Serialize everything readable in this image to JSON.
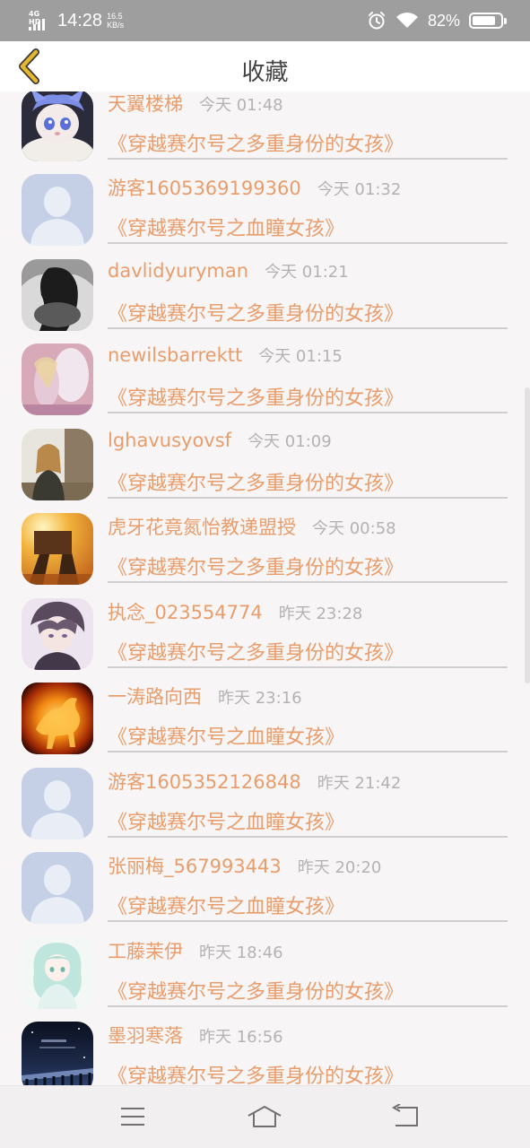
{
  "status_bar": {
    "network": "4G HD",
    "time": "14:28",
    "speed_value": "16.5",
    "speed_unit": "KB/s",
    "battery": "82%",
    "battery_level": 0.82,
    "icons": [
      "signal-icon",
      "alarm-icon",
      "wifi-icon",
      "battery-icon"
    ]
  },
  "nav": {
    "title": "收藏",
    "back_icon": "chevron-left-icon"
  },
  "colors": {
    "accent": "#e89d6c",
    "time": "#b3b3b3",
    "back": "#e3b72e",
    "status_bar": "#9e9e9e"
  },
  "items": [
    {
      "username": "天翼楼梯",
      "time": "今天 01:48",
      "book": "《穿越赛尔号之多重身份的女孩》",
      "avatar": "cat-avatar"
    },
    {
      "username": "游客1605369199360",
      "time": "今天 01:32",
      "book": "《穿越赛尔号之血瞳女孩》",
      "avatar": "default-avatar"
    },
    {
      "username": "davlidyuryman",
      "time": "今天 01:21",
      "book": "《穿越赛尔号之多重身份的女孩》",
      "avatar": "photo-avatar"
    },
    {
      "username": "newilsbarrektt",
      "time": "今天 01:15",
      "book": "《穿越赛尔号之多重身份的女孩》",
      "avatar": "photo-avatar"
    },
    {
      "username": "lghavusyovsf",
      "time": "今天 01:09",
      "book": "《穿越赛尔号之多重身份的女孩》",
      "avatar": "photo-avatar"
    },
    {
      "username": "虎牙花竟氮怡教递盟授",
      "time": "今天 00:58",
      "book": "《穿越赛尔号之多重身份的女孩》",
      "avatar": "photo-avatar"
    },
    {
      "username": "执念_023554774",
      "time": "昨天 23:28",
      "book": "《穿越赛尔号之多重身份的女孩》",
      "avatar": "anime-avatar"
    },
    {
      "username": "一涛路向西",
      "time": "昨天 23:16",
      "book": "《穿越赛尔号之血瞳女孩》",
      "avatar": "fire-avatar"
    },
    {
      "username": "游客1605352126848",
      "time": "昨天 21:42",
      "book": "《穿越赛尔号之血瞳女孩》",
      "avatar": "default-avatar"
    },
    {
      "username": "张丽梅_567993443",
      "time": "昨天 20:20",
      "book": "《穿越赛尔号之血瞳女孩》",
      "avatar": "default-avatar"
    },
    {
      "username": "工藤茉伊",
      "time": "昨天 18:46",
      "book": "《穿越赛尔号之多重身份的女孩》",
      "avatar": "anime-avatar"
    },
    {
      "username": "墨羽寒落",
      "time": "昨天 16:56",
      "book": "《穿越赛尔号之多重身份的女孩》",
      "avatar": "night-avatar"
    }
  ],
  "bottom_bar": {
    "buttons": [
      "menu-icon",
      "home-icon",
      "back-icon"
    ]
  }
}
